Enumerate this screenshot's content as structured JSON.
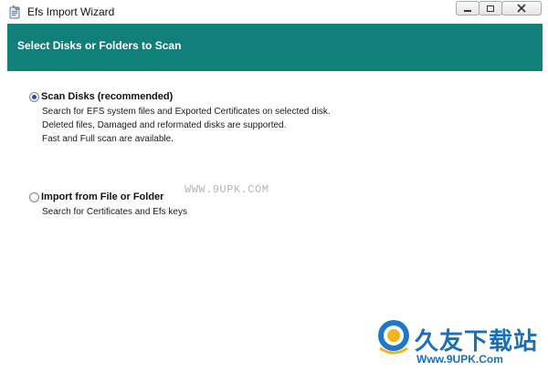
{
  "window": {
    "title": "Efs Import Wizard",
    "minimize_glyph": "—",
    "restore_glyph": "▢",
    "close_glyph": "✕"
  },
  "header": {
    "title": "Select Disks or Folders to Scan",
    "color": "#12807a"
  },
  "options": [
    {
      "label": "Scan Disks (recommended)",
      "selected": true,
      "description": [
        "Search for EFS system files and Exported Certificates on selected disk.",
        "Deleted files, Damaged and reformated disks are supported.",
        "Fast  and Full scan are available."
      ]
    },
    {
      "label": "Import from File or Folder",
      "selected": false,
      "description": [
        "Search for Certificates and Efs keys"
      ]
    }
  ],
  "watermark": {
    "text": "WWW.9UPK.COM"
  },
  "logo": {
    "cn_text": "久友下载站",
    "url_text": "Www.9UPK.Com",
    "brand_color": "#1a6fb8"
  }
}
